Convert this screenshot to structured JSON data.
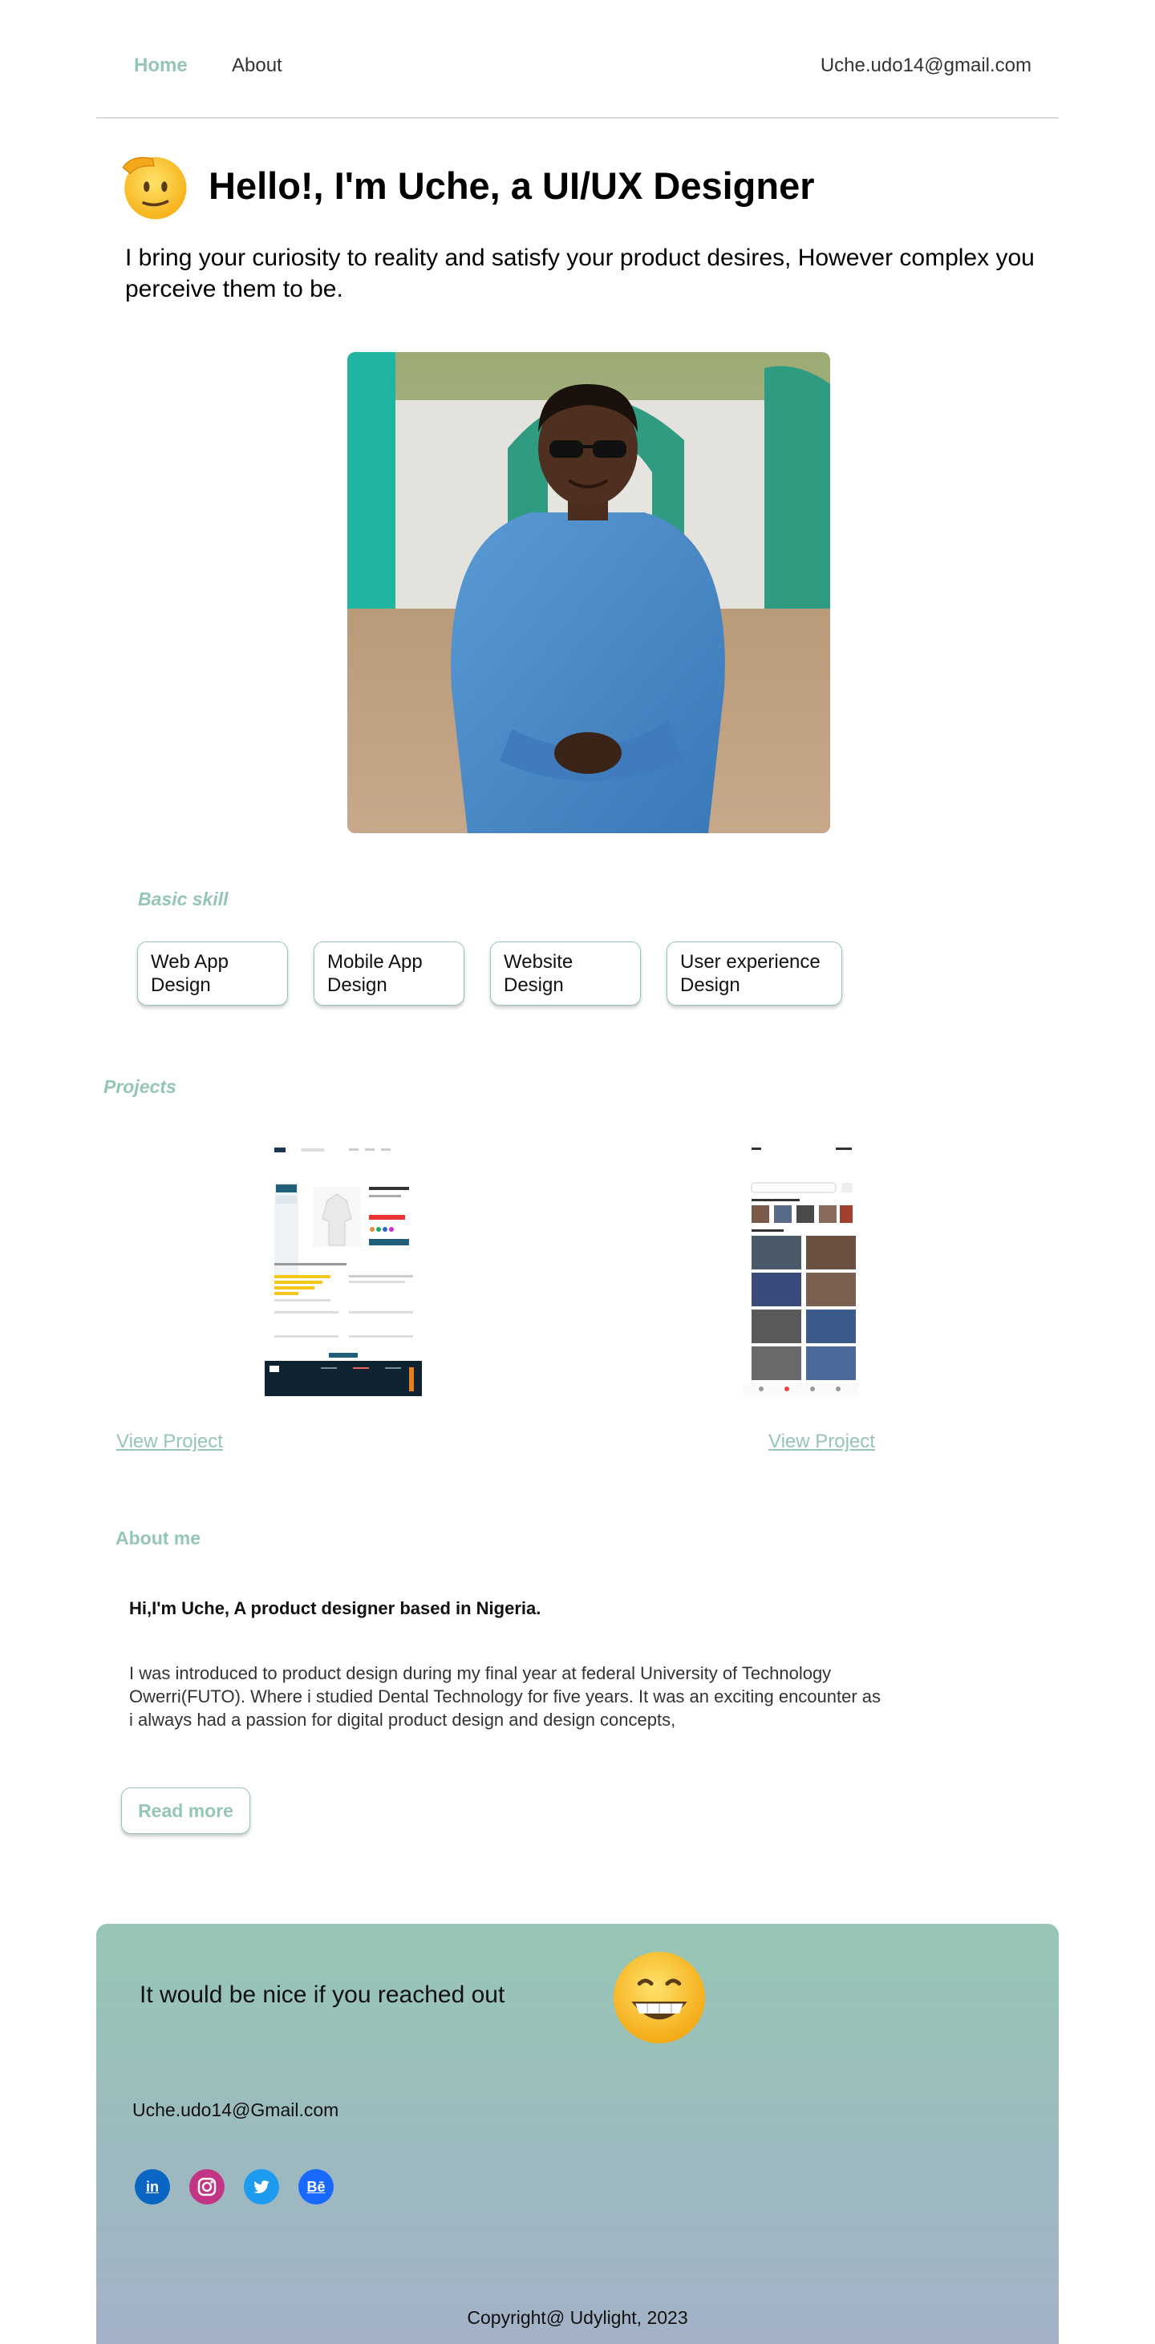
{
  "nav": {
    "home": "Home",
    "about": "About",
    "email": "Uche.udo14@gmail.com"
  },
  "hero": {
    "title": "Hello!, I'm Uche, a UI/UX Designer",
    "subtitle": "I bring your curiosity to reality and satisfy your product desires, However complex you perceive them to be."
  },
  "skills": {
    "label": "Basic skill",
    "items": [
      {
        "label": "Web App Design"
      },
      {
        "label": "Mobile App Design"
      },
      {
        "label": "Website Design"
      },
      {
        "label": "User experience Design"
      }
    ]
  },
  "projects": {
    "label": "Projects",
    "items": [
      {
        "link": "View Project"
      },
      {
        "link": "View Project"
      }
    ]
  },
  "about": {
    "label": "About me",
    "heading": "Hi,I'm Uche, A product designer based in Nigeria.",
    "body": "I was introduced to product design during my final year at federal University of Technology Owerri(FUTO). Where i studied Dental Technology for five years. It was an exciting encounter as i always had a passion for digital product design and design concepts,",
    "read_more": "Read more"
  },
  "footer": {
    "reach": "It would be nice if you reached out",
    "email": "Uche.udo14@Gmail.com",
    "socials": [
      {
        "icon": "linkedin-icon",
        "glyph": "in",
        "color": "#0a66c2"
      },
      {
        "icon": "instagram-icon",
        "glyph": "◎",
        "color": "#c13584"
      },
      {
        "icon": "twitter-icon",
        "glyph": "🐦",
        "color": "#1d9bf0"
      },
      {
        "icon": "behance-icon",
        "glyph": "Bē",
        "color": "#1769ff"
      }
    ],
    "copyright": "Copyright@ Udylight, 2023"
  },
  "colors": {
    "accent": "#95c6b5",
    "footer_top": "#97c6b5",
    "footer_bottom": "#a4b2c8"
  }
}
